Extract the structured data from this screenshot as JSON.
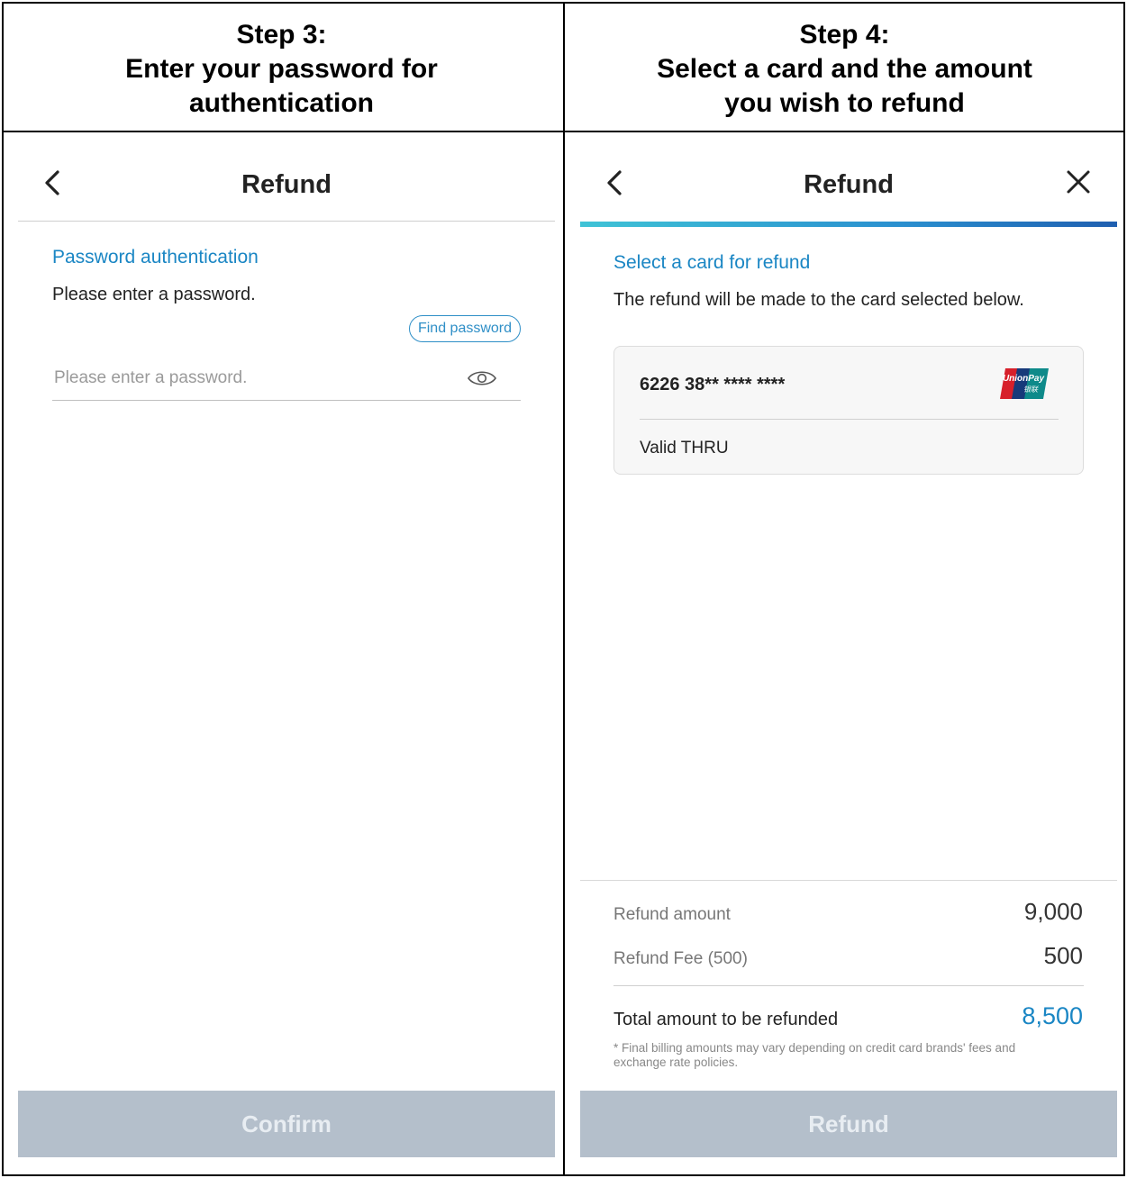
{
  "step3": {
    "heading_line1": "Step 3:",
    "heading_line2": "Enter your password for",
    "heading_line3": "authentication",
    "appbar_title": "Refund",
    "section_label": "Password authentication",
    "instruction": "Please enter a password.",
    "find_password_label": "Find password",
    "password_placeholder": "Please enter a password.",
    "password_value": "",
    "confirm_label": "Confirm"
  },
  "step4": {
    "heading_line1": "Step 4:",
    "heading_line2": "Select a card and the amount",
    "heading_line3": "you wish to refund",
    "appbar_title": "Refund",
    "section_label": "Select a card for refund",
    "instruction": "The refund will be made to the card selected below.",
    "card": {
      "number": "6226 38** **** ****",
      "valid_label": "Valid THRU",
      "brand": "UnionPay",
      "brand_sub": "银联",
      "logo_icon": "unionpay-logo"
    },
    "summary": {
      "refund_amount_label": "Refund amount",
      "refund_amount_value": "9,000",
      "refund_fee_label": "Refund Fee (500)",
      "refund_fee_value": "500",
      "total_label": "Total amount to be refunded",
      "total_value": "8,500",
      "footnote": "* Final billing amounts may vary depending on credit card brands' fees and exchange rate policies."
    },
    "refund_button_label": "Refund"
  },
  "colors": {
    "accent_blue": "#1a86c4",
    "disabled_button": "#b4bfcb",
    "border": "#000000"
  },
  "icons": [
    "back-arrow-icon",
    "close-icon",
    "eye-icon",
    "unionpay-logo"
  ]
}
